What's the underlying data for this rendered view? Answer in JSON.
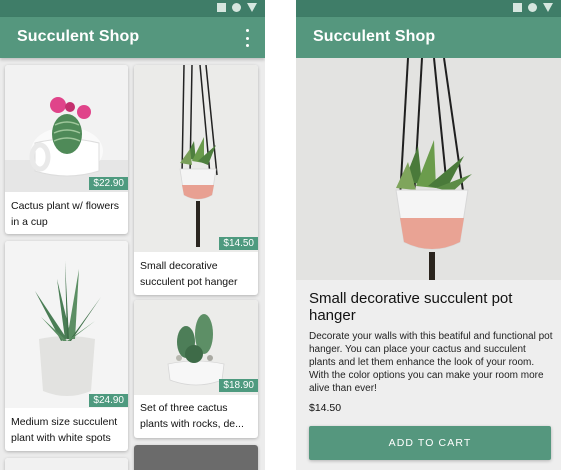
{
  "app": {
    "title": "Succulent Shop"
  },
  "list_screen": {
    "products": [
      {
        "name": "Cactus plant w/ flowers in a cup",
        "price": "$22.90"
      },
      {
        "name": "Small decorative succulent pot hanger",
        "price": "$14.50"
      },
      {
        "name": "Medium size succulent plant with white spots",
        "price": "$24.90"
      },
      {
        "name": "Set of three cactus plants with rocks, de...",
        "price": "$18.90"
      }
    ]
  },
  "detail_screen": {
    "title": "Small decorative succulent pot hanger",
    "description": "Decorate your walls with this beatiful and functional pot hanger. You can place your cactus and succulent plants and let them enhance the look of your room. With the color options you can make your room more alive than ever!",
    "price": "$14.50",
    "add_to_cart_label": "ADD TO CART"
  },
  "colors": {
    "status_bar": "#3f7d68",
    "app_bar": "#55977e",
    "accent": "#4e9a7f"
  }
}
